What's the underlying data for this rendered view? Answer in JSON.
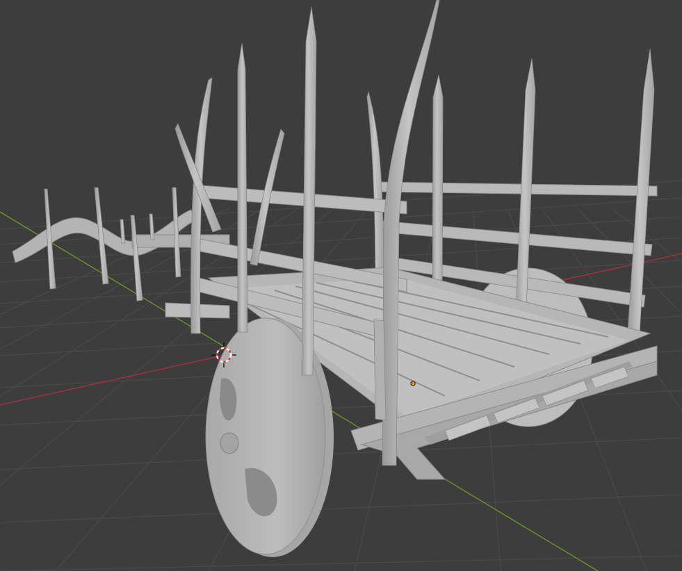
{
  "app": {
    "view": "3d-viewport",
    "shading": "solid"
  },
  "colors": {
    "background": "#3d3d3d",
    "grid": "#4a4a4a",
    "axis_x": "#a8303f",
    "axis_y": "#6d9228",
    "model": "#b8b8b8",
    "model_shadow": "#8e8e8e",
    "model_highlight": "#cfcfcf",
    "origin_dot": "#f08a1c",
    "cursor_red": "#d8303a",
    "cursor_white": "#ffffff"
  },
  "scene": {
    "object": "ox-cart",
    "icons": [
      "3d-cursor-icon",
      "object-origin-icon"
    ]
  }
}
